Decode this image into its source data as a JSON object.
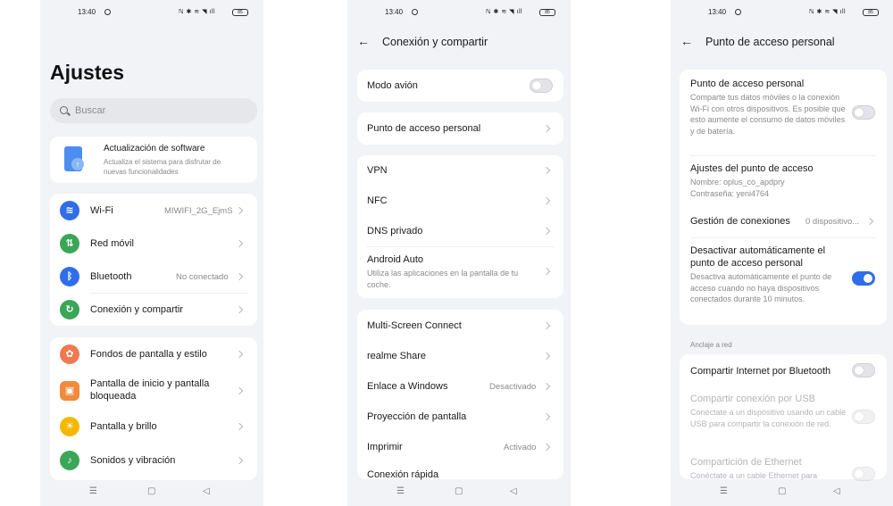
{
  "status": {
    "time": "13:40",
    "icons": "ℕ ✱ ≋ ◥ ıll",
    "battery": "85"
  },
  "screen1": {
    "title": "Ajustes",
    "search_placeholder": "Buscar",
    "update": {
      "title": "Actualización de software",
      "subtitle": "Actualiza el sistema para disfrutar de nuevas funcionalidades"
    },
    "items_a": [
      {
        "label": "Wi-Fi",
        "value": "MIWIFI_2G_EjmS"
      },
      {
        "label": "Red móvil",
        "value": ""
      },
      {
        "label": "Bluetooth",
        "value": "No conectado"
      },
      {
        "label": "Conexión y compartir",
        "value": ""
      }
    ],
    "items_b": [
      {
        "label": "Fondos de pantalla y estilo"
      },
      {
        "label": "Pantalla de inicio y pantalla bloqueada"
      },
      {
        "label": "Pantalla y brillo"
      },
      {
        "label": "Sonidos y vibración"
      }
    ]
  },
  "screen2": {
    "header": "Conexión y compartir",
    "airplane": "Modo avión",
    "hotspot": "Punto de acceso personal",
    "group2": [
      {
        "label": "VPN"
      },
      {
        "label": "NFC"
      },
      {
        "label": "DNS privado"
      },
      {
        "label": "Android Auto",
        "desc": "Utiliza las aplicaciones en la pantalla de tu coche."
      }
    ],
    "group3": [
      {
        "label": "Multi-Screen Connect",
        "value": ""
      },
      {
        "label": "realme Share",
        "value": ""
      },
      {
        "label": "Enlace a Windows",
        "value": "Desactivado"
      },
      {
        "label": "Proyección de pantalla",
        "value": ""
      },
      {
        "label": "Imprimir",
        "value": "Activado"
      },
      {
        "label": "Conexión rápida",
        "value": ""
      }
    ]
  },
  "screen3": {
    "header": "Punto de acceso personal",
    "hotspot": {
      "label": "Punto de acceso personal",
      "desc": "Comparte tus datos móviles o la conexión Wi-Fi con otros dispositivos. Es posible que esto aumente el consumo de datos móviles y de batería."
    },
    "settings": {
      "label": "Ajustes del punto de acceso",
      "name": "Nombre: oplus_co_apdpry",
      "password": "Contraseña: yeni4764"
    },
    "manage": {
      "label": "Gestión de conexiones",
      "value": "0 dispositivo..."
    },
    "auto_off": {
      "label": "Desactivar automáticamente el punto de acceso personal",
      "desc": "Desactiva automáticamente el punto de acceso cuando no haya dispositivos conectados durante 10 minutos."
    },
    "section": "Anclaje a red",
    "bt": "Compartir Internet por Bluetooth",
    "usb": {
      "label": "Compartir conexión por USB",
      "desc": "Conéctate a un dispositivo usando un cable USB para compartir la conexión de red."
    },
    "eth": {
      "label": "Compartición de Ethernet",
      "desc": "Conéctate a un cable Ethernet para"
    }
  },
  "nav": {
    "menu": "☰",
    "home": "▢",
    "back": "◁"
  },
  "colors": {
    "accent": "#2f6ee8",
    "wifi": "#2f6ee8",
    "mobile": "#3aa657",
    "bluetooth": "#2f6ee8",
    "share": "#3aa657",
    "wallpaper": "#ee7a52",
    "home": "#f08a3c",
    "display": "#f5b800",
    "sound": "#3aa657"
  }
}
